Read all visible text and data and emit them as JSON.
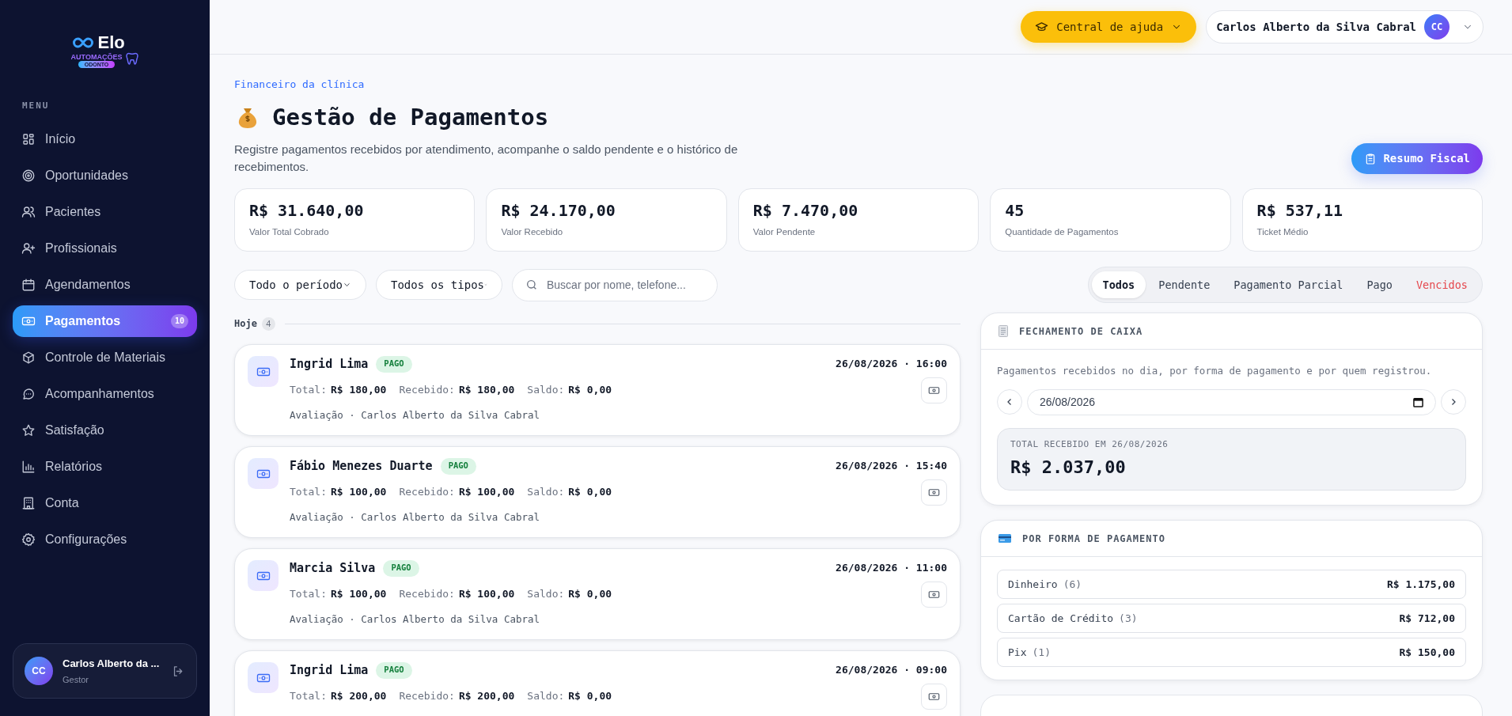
{
  "sidebar": {
    "logo": {
      "name": "Elo",
      "line1": "AUTOMAÇÕES",
      "line2": "ODONTO"
    },
    "menu_label": "MENU",
    "items": [
      {
        "label": "Início",
        "selected": false
      },
      {
        "label": "Oportunidades",
        "selected": false
      },
      {
        "label": "Pacientes",
        "selected": false
      },
      {
        "label": "Profissionais",
        "selected": false
      },
      {
        "label": "Agendamentos",
        "selected": false
      },
      {
        "label": "Pagamentos",
        "selected": true,
        "badge": "10"
      },
      {
        "label": "Controle de Materiais",
        "selected": false
      },
      {
        "label": "Acompanhamentos",
        "selected": false
      },
      {
        "label": "Satisfação",
        "selected": false
      },
      {
        "label": "Relatórios",
        "selected": false
      },
      {
        "label": "Conta",
        "selected": false
      },
      {
        "label": "Configurações",
        "selected": false
      }
    ],
    "user": {
      "initials": "CC",
      "name": "Carlos Alberto da ...",
      "role": "Gestor"
    }
  },
  "header": {
    "help_button": "Central de ajuda",
    "user_menu": {
      "name": "Carlos Alberto da Silva Cabral",
      "initials": "CC"
    }
  },
  "page": {
    "eyebrow": "Financeiro da clínica",
    "title": "Gestão de Pagamentos",
    "description": "Registre pagamentos recebidos por atendimento, acompanhe o saldo pendente e o histórico de recebimentos.",
    "action_button": "Resumo Fiscal"
  },
  "stats": [
    {
      "value": "R$ 31.640,00",
      "label": "Valor Total Cobrado"
    },
    {
      "value": "R$ 24.170,00",
      "label": "Valor Recebido"
    },
    {
      "value": "R$ 7.470,00",
      "label": "Valor Pendente"
    },
    {
      "value": "45",
      "label": "Quantidade de Pagamentos"
    },
    {
      "value": "R$ 537,11",
      "label": "Ticket Médio"
    }
  ],
  "filters": {
    "period": "Todo o período",
    "type": "Todos os tipos",
    "search_placeholder": "Buscar por nome, telefone..."
  },
  "status_tabs": [
    {
      "label": "Todos",
      "selected": true,
      "alert": false
    },
    {
      "label": "Pendente",
      "selected": false,
      "alert": false
    },
    {
      "label": "Pagamento Parcial",
      "selected": false,
      "alert": false
    },
    {
      "label": "Pago",
      "selected": false,
      "alert": false
    },
    {
      "label": "Vencidos",
      "selected": false,
      "alert": true
    }
  ],
  "group": {
    "label": "Hoje",
    "count": "4"
  },
  "payments": [
    {
      "name": "Ingrid Lima",
      "status": "PAGO",
      "datetime": "26/08/2026 · 16:00",
      "total_label": "Total:",
      "total": "R$ 180,00",
      "received_label": "Recebido:",
      "received": "R$ 180,00",
      "balance_label": "Saldo:",
      "balance": "R$ 0,00",
      "note": "Avaliação · Carlos Alberto da Silva Cabral"
    },
    {
      "name": "Fábio Menezes Duarte",
      "status": "PAGO",
      "datetime": "26/08/2026 · 15:40",
      "total_label": "Total:",
      "total": "R$ 100,00",
      "received_label": "Recebido:",
      "received": "R$ 100,00",
      "balance_label": "Saldo:",
      "balance": "R$ 0,00",
      "note": "Avaliação · Carlos Alberto da Silva Cabral"
    },
    {
      "name": "Marcia Silva",
      "status": "PAGO",
      "datetime": "26/08/2026 · 11:00",
      "total_label": "Total:",
      "total": "R$ 100,00",
      "received_label": "Recebido:",
      "received": "R$ 100,00",
      "balance_label": "Saldo:",
      "balance": "R$ 0,00",
      "note": "Avaliação · Carlos Alberto da Silva Cabral"
    },
    {
      "name": "Ingrid Lima",
      "status": "PAGO",
      "datetime": "26/08/2026 · 09:00",
      "total_label": "Total:",
      "total": "R$ 200,00",
      "received_label": "Recebido:",
      "received": "R$ 200,00",
      "balance_label": "Saldo:",
      "balance": "R$ 0,00"
    }
  ],
  "cash_closing": {
    "title": "FECHAMENTO DE CAIXA",
    "description": "Pagamentos recebidos no dia, por forma de pagamento e por quem registrou.",
    "date": "26/08/2026",
    "total_label": "TOTAL RECEBIDO EM 26/08/2026",
    "total": "R$ 2.037,00"
  },
  "payment_methods": {
    "title": "POR FORMA DE PAGAMENTO",
    "rows": [
      {
        "label": "Dinheiro",
        "count": "(6)",
        "amount": "R$ 1.175,00"
      },
      {
        "label": "Cartão de Crédito",
        "count": "(3)",
        "amount": "R$ 712,00"
      },
      {
        "label": "Pix",
        "count": "(1)",
        "amount": "R$ 150,00"
      }
    ]
  }
}
